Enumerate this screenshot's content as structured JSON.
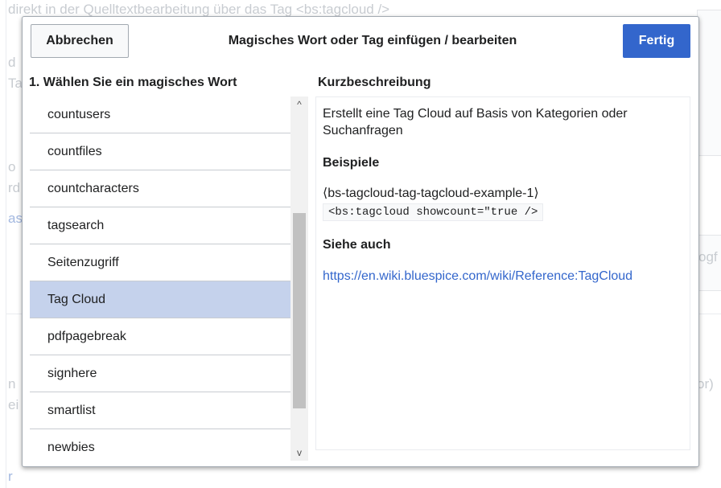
{
  "background": {
    "top_text": "direkt in der Quelltextbearbeitung über das Tag <bs:tagcloud />",
    "fragments": [
      "d",
      "Tag",
      "o",
      "rd",
      "ase",
      "n",
      "ei",
      "r",
      "ogf",
      "or)"
    ]
  },
  "dialog": {
    "title": "Magisches Wort oder Tag einfügen / bearbeiten",
    "cancel_label": "Abbrechen",
    "done_label": "Fertig",
    "left_heading": "1. Wählen Sie ein magisches Wort",
    "right_heading": "Kurzbeschreibung",
    "list": [
      {
        "label": "countusers"
      },
      {
        "label": "countfiles"
      },
      {
        "label": "countcharacters"
      },
      {
        "label": "tagsearch"
      },
      {
        "label": "Seitenzugriff"
      },
      {
        "label": "Tag Cloud"
      },
      {
        "label": "pdfpagebreak"
      },
      {
        "label": "signhere"
      },
      {
        "label": "smartlist"
      },
      {
        "label": "newbies"
      }
    ],
    "selected_index": 5,
    "scroll_up": "^",
    "scroll_down": "v",
    "description": {
      "text": "Erstellt eine Tag Cloud auf Basis von Kategorien oder Suchanfragen",
      "examples_heading": "Beispiele",
      "example_name": "⟨bs-tagcloud-tag-tagcloud-example-1⟩",
      "example_code": "<bs:tagcloud showcount=\"true />",
      "see_also_heading": "Siehe auch",
      "link": "https://en.wiki.bluespice.com/wiki/Reference:TagCloud"
    }
  },
  "colors": {
    "primary": "#3366cc",
    "selected_row": "#c5d2ec",
    "link": "#3366cc"
  }
}
